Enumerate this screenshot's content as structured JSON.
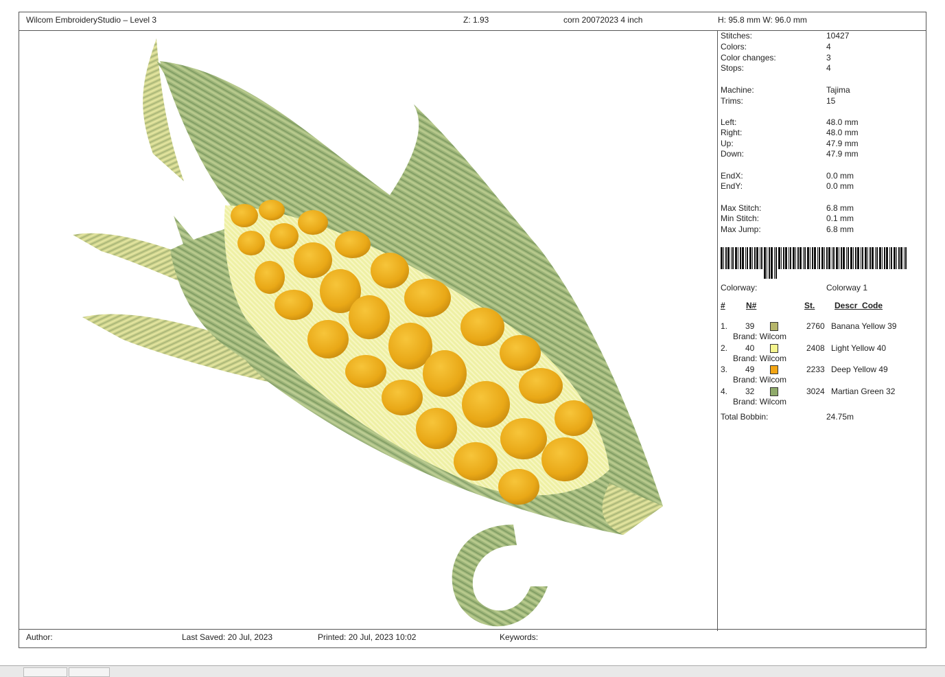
{
  "header": {
    "app_title": "Wilcom EmbroideryStudio – Level 3",
    "zoom": "Z: 1.93",
    "design_name": "corn 20072023 4 inch",
    "dimensions": "H: 95.8 mm   W: 96.0 mm"
  },
  "stats": [
    {
      "label": "Stitches:",
      "value": "10427"
    },
    {
      "label": "Colors:",
      "value": "4"
    },
    {
      "label": "Color changes:",
      "value": "3"
    },
    {
      "label": "Stops:",
      "value": "4"
    },
    {
      "label": "Machine:",
      "value": "Tajima"
    },
    {
      "label": "Trims:",
      "value": "15"
    },
    {
      "label": "Left:",
      "value": "48.0 mm"
    },
    {
      "label": "Right:",
      "value": "48.0 mm"
    },
    {
      "label": "Up:",
      "value": "47.9 mm"
    },
    {
      "label": "Down:",
      "value": "47.9 mm"
    },
    {
      "label": "EndX:",
      "value": "0.0 mm"
    },
    {
      "label": "EndY:",
      "value": "0.0 mm"
    },
    {
      "label": "Max Stitch:",
      "value": "6.8 mm"
    },
    {
      "label": "Min Stitch:",
      "value": "0.1 mm"
    },
    {
      "label": "Max Jump:",
      "value": "6.8 mm"
    }
  ],
  "colorway": {
    "label": "Colorway:",
    "value": "Colorway 1"
  },
  "color_table": {
    "headers": {
      "num": "#",
      "n": "N#",
      "st": "St.",
      "descr": "Descr_Code"
    },
    "rows": [
      {
        "idx": "1.",
        "n": "39",
        "swatch": "#b5b56a",
        "brand": "Brand: Wilcom",
        "st": "2760",
        "descr": "Banana Yellow 39"
      },
      {
        "idx": "2.",
        "n": "40",
        "swatch": "#f5f58e",
        "brand": "Brand: Wilcom",
        "st": "2408",
        "descr": "Light Yellow 40"
      },
      {
        "idx": "3.",
        "n": "49",
        "swatch": "#f2a413",
        "brand": "Brand: Wilcom",
        "st": "2233",
        "descr": "Deep Yellow 49"
      },
      {
        "idx": "4.",
        "n": "32",
        "swatch": "#8faa6b",
        "brand": "Brand: Wilcom",
        "st": "3024",
        "descr": "Martian Green 32"
      }
    ],
    "total_bobbin_label": "Total Bobbin:",
    "total_bobbin_value": "24.75m"
  },
  "footer": {
    "author": "Author:",
    "last_saved": "Last Saved: 20 Jul, 2023",
    "printed": "Printed: 20 Jul, 2023 10:02",
    "keywords": "Keywords:"
  },
  "colors": {
    "husk_dark": "#8faa6b",
    "husk_light": "#b9c98a",
    "kernel": "#f0b024",
    "kernel_base": "#eef0a0"
  },
  "icons": [
    "barcode-icon"
  ]
}
